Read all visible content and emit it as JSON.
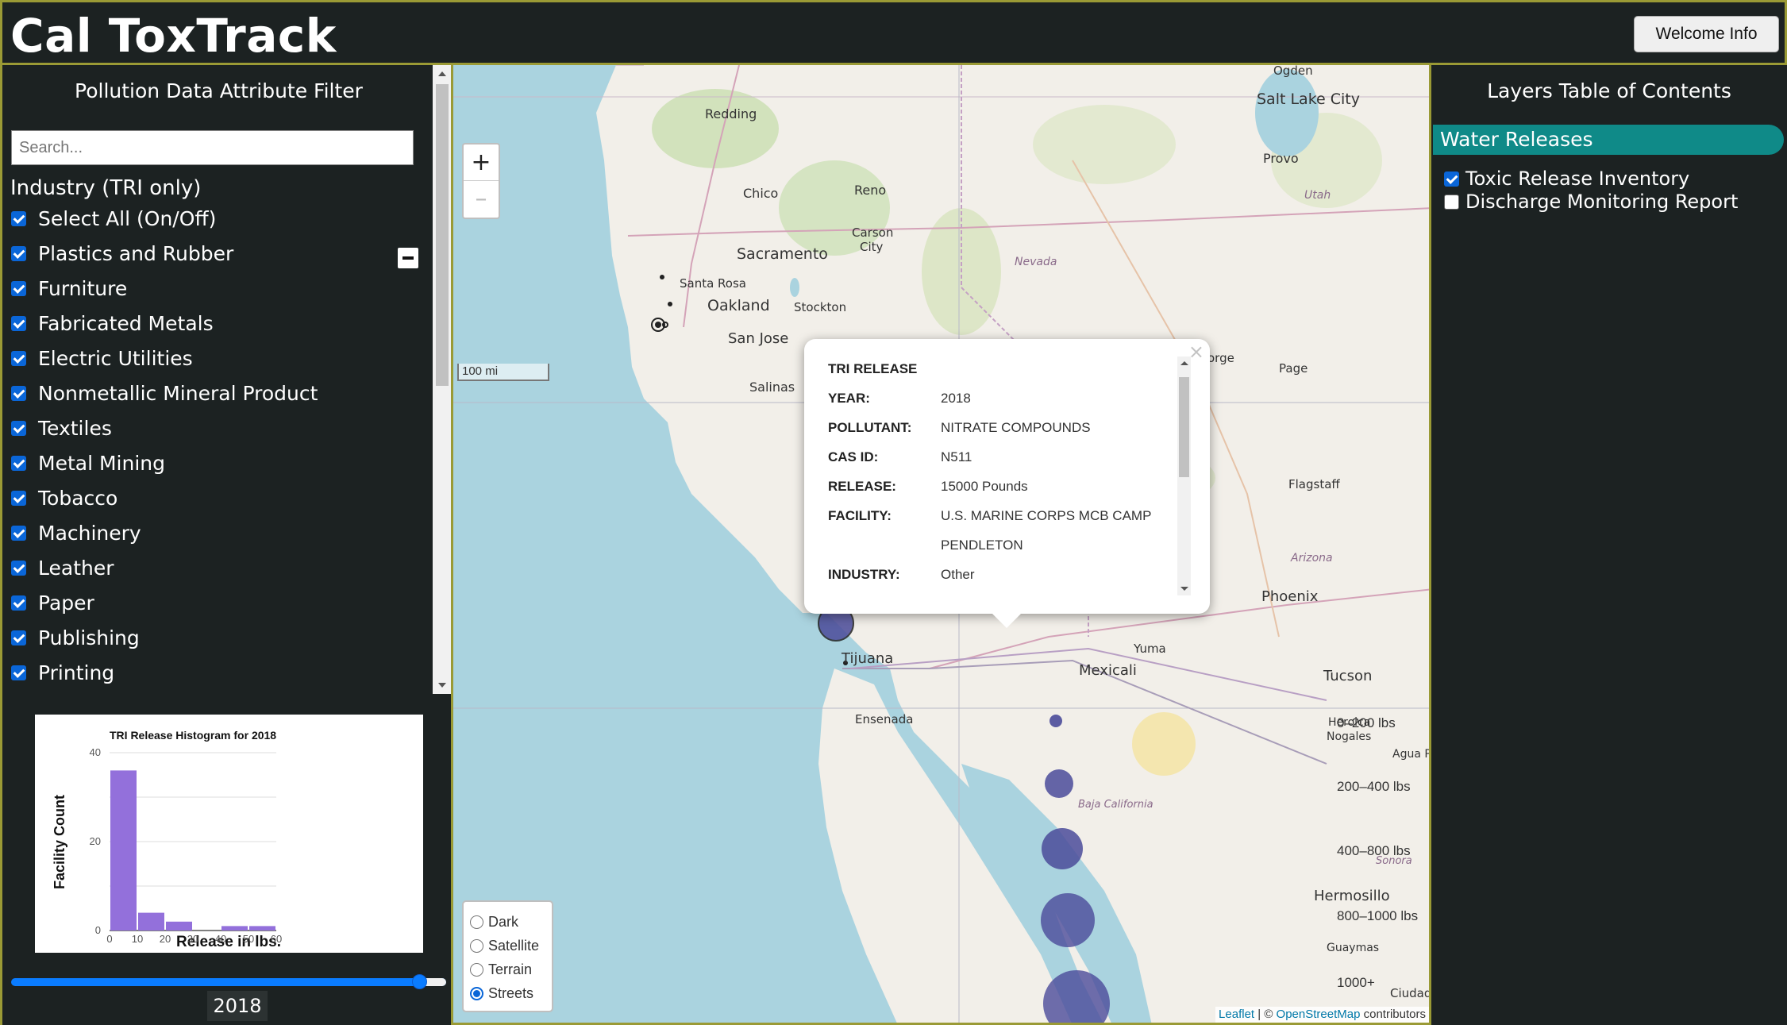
{
  "app": {
    "title": "Cal ToxTrack",
    "welcome_button": "Welcome Info"
  },
  "filter_panel": {
    "title": "Pollution Data Attribute Filter",
    "search_placeholder": "Search...",
    "section_title": "Industry (TRI only)",
    "items": [
      {
        "label": "Select All (On/Off)",
        "checked": true
      },
      {
        "label": "Plastics and Rubber",
        "checked": true
      },
      {
        "label": "Furniture",
        "checked": true
      },
      {
        "label": "Fabricated Metals",
        "checked": true
      },
      {
        "label": "Electric Utilities",
        "checked": true
      },
      {
        "label": "Nonmetallic Mineral Product",
        "checked": true
      },
      {
        "label": "Textiles",
        "checked": true
      },
      {
        "label": "Metal Mining",
        "checked": true
      },
      {
        "label": "Tobacco",
        "checked": true
      },
      {
        "label": "Machinery",
        "checked": true
      },
      {
        "label": "Leather",
        "checked": true
      },
      {
        "label": "Paper",
        "checked": true
      },
      {
        "label": "Publishing",
        "checked": true
      },
      {
        "label": "Printing",
        "checked": true
      }
    ],
    "year_value": "2018"
  },
  "chart_data": {
    "type": "bar",
    "title": "TRI Release Histogram for 2018",
    "xlabel": "Release in lbs.",
    "ylabel": "Facility Count",
    "bins": [
      {
        "start": 0,
        "end": 10,
        "value": 36
      },
      {
        "start": 10,
        "end": 20,
        "value": 4
      },
      {
        "start": 20,
        "end": 30,
        "value": 2
      },
      {
        "start": 30,
        "end": 40,
        "value": 0
      },
      {
        "start": 40,
        "end": 50,
        "value": 1
      },
      {
        "start": 50,
        "end": 60,
        "value": 1
      }
    ],
    "xticks": [
      0,
      10,
      20,
      30,
      40,
      50,
      60
    ],
    "yticks": [
      0,
      20,
      40
    ],
    "xlim": [
      0,
      60
    ],
    "ylim": [
      0,
      40
    ],
    "color": "#9370db",
    "grid": true
  },
  "map": {
    "zoom_in": "+",
    "zoom_out": "–",
    "scale": "100 mi",
    "places": {
      "ogden": "Ogden",
      "slc": "Salt Lake City",
      "redding": "Redding",
      "provo": "Provo",
      "chico": "Chico",
      "reno": "Reno",
      "utah": "Utah",
      "carson": "Carson",
      "city": "City",
      "sacramento": "Sacramento",
      "nevada": "Nevada",
      "santa_rosa": "Santa Rosa",
      "oakland": "Oakland",
      "stockton": "Stockton",
      "san_jose": "San Jose",
      "salinas": "Salinas",
      "orge": "orge",
      "page": "Page",
      "flagstaff": "Flagstaff",
      "arizona": "Arizona",
      "phoenix": "Phoenix",
      "yuma": "Yuma",
      "tijuana": "Tijuana",
      "mexicali": "Mexicali",
      "tucson": "Tucson",
      "ensenada": "Ensenada",
      "nogales": "Nogales",
      "agua": "Agua P",
      "baja": "Baja California",
      "sonora": "Sonora",
      "hermosillo": "Hermosillo",
      "guaymas": "Guaymas",
      "ciudad": "Ciudad",
      "heroica": "Heroica"
    },
    "popup": {
      "title": "TRI RELEASE",
      "rows": [
        {
          "key": "YEAR:",
          "value": "2018"
        },
        {
          "key": "POLLUTANT:",
          "value": "NITRATE COMPOUNDS"
        },
        {
          "key": "CAS ID:",
          "value": "N511"
        },
        {
          "key": "RELEASE:",
          "value": "15000 Pounds"
        },
        {
          "key": "FACILITY:",
          "value": "U.S. MARINE CORPS MCB CAMP PENDLETON"
        },
        {
          "key": "INDUSTRY:",
          "value": "Other"
        }
      ],
      "close": "×"
    },
    "legend": [
      {
        "label": "0–200 lbs"
      },
      {
        "label": "200–400 lbs"
      },
      {
        "label": "400–800 lbs"
      },
      {
        "label": "800–1000 lbs"
      },
      {
        "label": "1000+"
      }
    ],
    "basemaps": [
      {
        "label": "Dark",
        "selected": false
      },
      {
        "label": "Satellite",
        "selected": false
      },
      {
        "label": "Terrain",
        "selected": false
      },
      {
        "label": "Streets",
        "selected": true
      }
    ],
    "attribution": {
      "leaflet": "Leaflet",
      "sep": " | © ",
      "osm": "OpenStreetMap",
      "contrib": " contributors"
    }
  },
  "toc": {
    "title": "Layers Table of Contents",
    "group": "Water Releases",
    "layers": [
      {
        "label": "Toxic Release Inventory",
        "checked": true
      },
      {
        "label": "Discharge Monitoring Report",
        "checked": false
      }
    ]
  }
}
